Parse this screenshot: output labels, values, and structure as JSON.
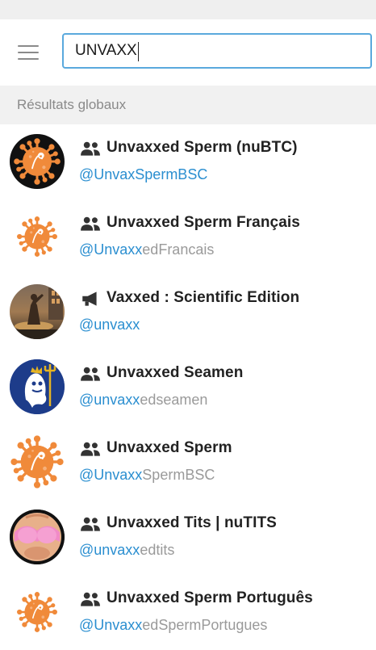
{
  "search": {
    "value": "UNVAXX"
  },
  "section_label": "Résultats globaux",
  "colors": {
    "accent": "#5aa9dd",
    "handle_match": "#2a8ed0",
    "handle_rest": "#9a9a9a",
    "virus_orange": "#f08a3a"
  },
  "results": [
    {
      "title": "Unvaxxed Sperm (nuBTC)",
      "handle_match": "@UnvaxSpermBSC",
      "handle_rest": "",
      "type_icon": "group-icon",
      "avatar": "virus-black-bg"
    },
    {
      "title": "Unvaxxed Sperm Français",
      "handle_match": "@Unvaxx",
      "handle_rest": "edFrancais",
      "type_icon": "group-icon",
      "avatar": "virus-small"
    },
    {
      "title": "Vaxxed : Scientific Edition",
      "handle_match": "@unvaxx",
      "handle_rest": "",
      "type_icon": "megaphone-icon",
      "avatar": "photo-fountain"
    },
    {
      "title": "Unvaxxed Seamen",
      "handle_match": "@unvaxx",
      "handle_rest": "edseamen",
      "type_icon": "group-icon",
      "avatar": "ghost-trident"
    },
    {
      "title": "Unvaxxed Sperm",
      "handle_match": "@Unvaxx",
      "handle_rest": "SpermBSC",
      "type_icon": "group-icon",
      "avatar": "virus-large"
    },
    {
      "title": "Unvaxxed Tits | nuTITS",
      "handle_match": "@unvaxx",
      "handle_rest": "edtits",
      "type_icon": "group-icon",
      "avatar": "tits-pink"
    },
    {
      "title": "Unvaxxed Sperm Português",
      "handle_match": "@Unvaxx",
      "handle_rest": "edSpermPortugues",
      "type_icon": "group-icon",
      "avatar": "virus-small"
    }
  ]
}
